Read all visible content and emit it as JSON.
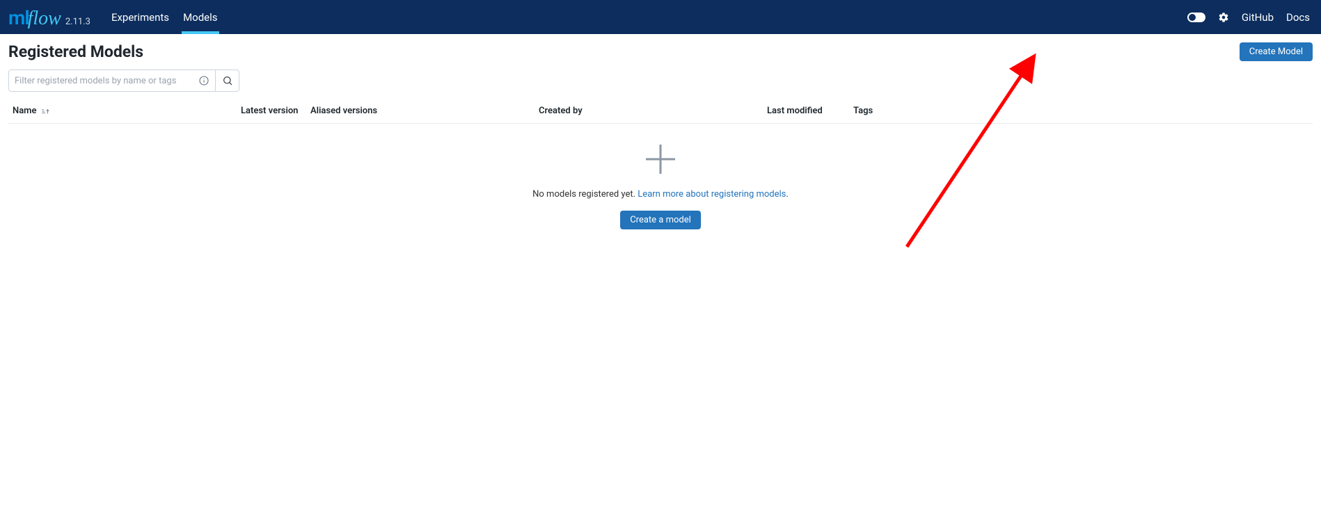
{
  "header": {
    "logo_ml": "ml",
    "logo_flow": "flow",
    "version": "2.11.3",
    "nav": {
      "experiments": "Experiments",
      "models": "Models"
    },
    "links": {
      "github": "GitHub",
      "docs": "Docs"
    }
  },
  "page": {
    "title": "Registered Models",
    "create_button": "Create Model",
    "filter_placeholder": "Filter registered models by name or tags"
  },
  "table": {
    "cols": {
      "name": "Name",
      "latest": "Latest version",
      "aliased": "Aliased versions",
      "created": "Created by",
      "modified": "Last modified",
      "tags": "Tags"
    }
  },
  "empty": {
    "text_prefix": "No models registered yet. ",
    "link": "Learn more about registering models",
    "text_suffix": ".",
    "create_button": "Create a model"
  }
}
